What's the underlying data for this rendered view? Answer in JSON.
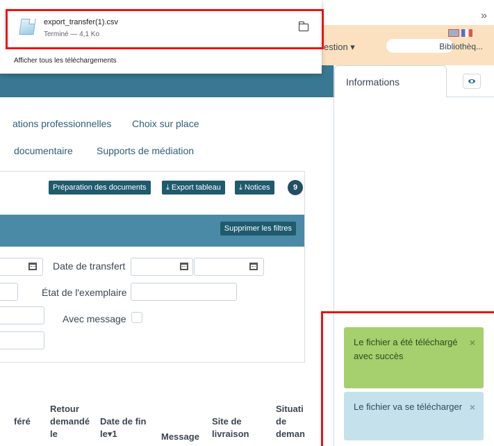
{
  "browser": {
    "chevron": "»"
  },
  "header": {
    "menu_label": "estion ▾",
    "library_label": "Bibliothèq..."
  },
  "right_panel": {
    "info_tab": "Informations"
  },
  "nav": {
    "link1": "ations professionnelles",
    "link2": "Choix sur place",
    "link3": "documentaire",
    "link4": "Supports de médiation"
  },
  "toolbar": {
    "prep_docs": "Préparation des documents",
    "export_table": "⤓ Export tableau",
    "notices": "⤓ Notices",
    "count": "9",
    "clear_filters": "Supprimer les filtres"
  },
  "filters": {
    "transfer_date_label": "Date de transfert",
    "copy_state_label": "État de l'exemplaire",
    "with_message_label": "Avec message"
  },
  "table": {
    "headers": [
      "féré",
      "Retour\ndemandé\nle",
      "Date de fin\nle▾1",
      "Message",
      "Site de\nlivraison",
      "Situati\nde\ndeman"
    ]
  },
  "download": {
    "filename": "export_transfer(1).csv",
    "status": "Terminé — 4,1 Ko",
    "show_all": "Afficher tous les téléchargements"
  },
  "toasts": {
    "success": "Le fichier a été téléchargé avec succès",
    "info": "Le fichier va se télécharger",
    "close": "×"
  },
  "colors": {
    "teal": "#3a7792",
    "header_orange": "#fbe1bf",
    "success_green": "#a6d06e",
    "info_blue": "#c5e2ec",
    "highlight_red": "#ee1111"
  }
}
